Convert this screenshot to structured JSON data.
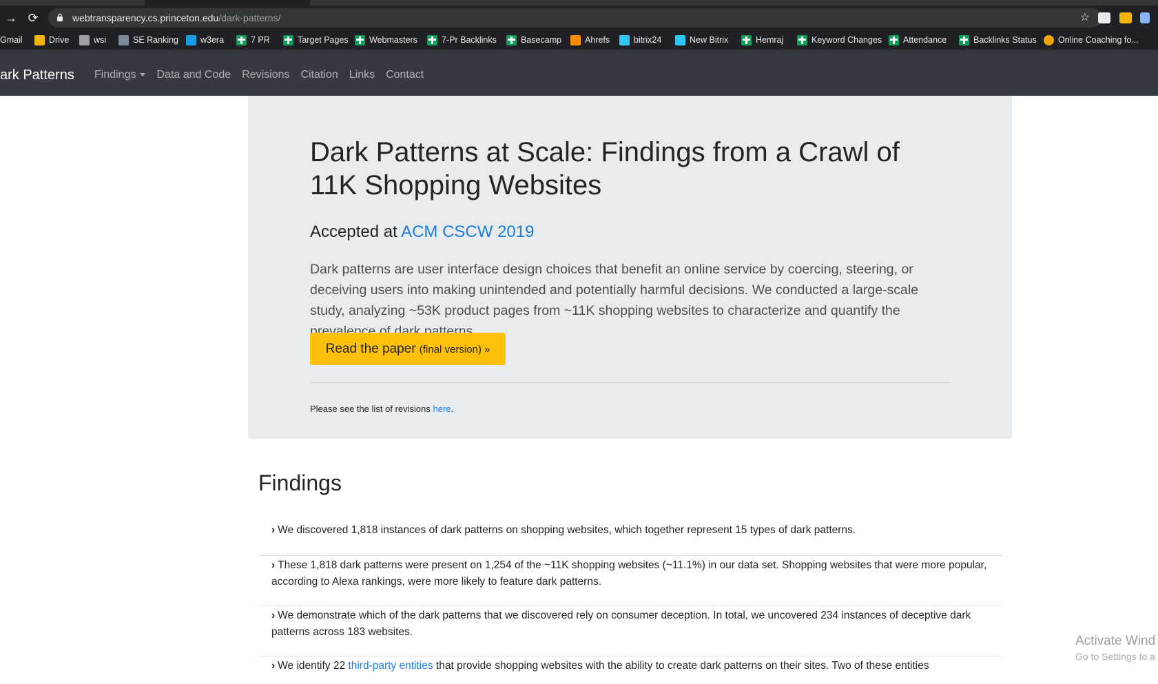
{
  "browser": {
    "url_host": "webtransparency.cs.princeton.edu",
    "url_path": "/dark-patterns/",
    "bookmarks": [
      {
        "label": "Gmail",
        "icon": "gmail-icon"
      },
      {
        "label": "Drive",
        "icon": "drive-icon"
      },
      {
        "label": "wsi",
        "icon": "wsi-icon"
      },
      {
        "label": "SE Ranking",
        "icon": "se-ranking-icon"
      },
      {
        "label": "w3era",
        "icon": "w3era-icon"
      },
      {
        "label": "7 PR",
        "icon": "sheets-icon"
      },
      {
        "label": "Target Pages",
        "icon": "sheets-icon"
      },
      {
        "label": "Webmasters",
        "icon": "sheets-icon"
      },
      {
        "label": "7-Pr Backlinks",
        "icon": "sheets-icon"
      },
      {
        "label": "Basecamp",
        "icon": "sheets-icon"
      },
      {
        "label": "Ahrefs",
        "icon": "ahrefs-icon"
      },
      {
        "label": "bitrix24",
        "icon": "bitrix-icon"
      },
      {
        "label": "New Bitrix",
        "icon": "bitrix-icon"
      },
      {
        "label": "Hemraj",
        "icon": "sheets-icon"
      },
      {
        "label": "Keyword Changes",
        "icon": "sheets-icon"
      },
      {
        "label": "Attendance",
        "icon": "sheets-icon"
      },
      {
        "label": "Backlinks Status",
        "icon": "sheets-icon"
      },
      {
        "label": "Online Coaching fo...",
        "icon": "coaching-icon"
      }
    ]
  },
  "navbar": {
    "brand": "ark Patterns",
    "links": [
      "Findings",
      "Data and Code",
      "Revisions",
      "Citation",
      "Links",
      "Contact"
    ]
  },
  "hero": {
    "title": "Dark Patterns at Scale: Findings from a Crawl of 11K Shopping Websites",
    "accepted_prefix": "Accepted at ",
    "accepted_link": "ACM CSCW 2019",
    "lead": "Dark patterns are user interface design choices that benefit an online service by coercing, steering, or deceiving users into making unintended and potentially harmful decisions. We conducted a large-scale study, analyzing ~53K product pages from ~11K shopping websites to characterize and quantify the prevalence of dark patterns.",
    "button_main": "Read the paper ",
    "button_small": "(final version) »",
    "revisions_prefix": "Please see the list of revisions ",
    "revisions_link": "here",
    "revisions_suffix": "."
  },
  "findings": {
    "heading": "Findings",
    "items": [
      {
        "text": "We discovered 1,818 instances of dark patterns on shopping websites, which together represent 15 types of dark patterns."
      },
      {
        "text": "These 1,818 dark patterns were present on 1,254 of the ~11K shopping websites (~11.1%) in our data set. Shopping websites that were more popular, according to Alexa rankings, were more likely to feature dark patterns."
      },
      {
        "text": "We demonstrate which of the dark patterns that we discovered rely on consumer deception. In total, we uncovered 234 instances of deceptive dark patterns across 183 websites."
      },
      {
        "prefix": "We identify 22 ",
        "link": "third-party entities",
        "suffix": " that provide shopping websites with the ability to create dark patterns on their sites. Two of these entities"
      }
    ]
  },
  "watermark": {
    "line1": "Activate Wind",
    "line2": "Go to Settings to a"
  },
  "colors": {
    "navbar_bg": "#343a40",
    "jumbotron_bg": "#e9ecef",
    "button_bg": "#ffc107",
    "link": "#1e7ce0"
  }
}
